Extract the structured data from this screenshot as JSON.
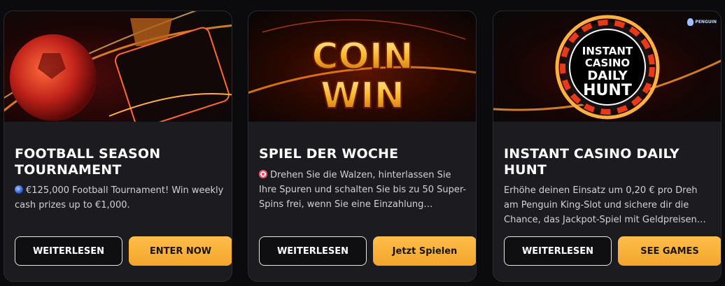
{
  "cards": [
    {
      "title": "FOOTBALL SEASON TOURNAMENT",
      "desc_emoji": "globe-icon",
      "description": "€125,000 Football Tournament! Win weekly cash prizes up to €1,000.",
      "read_label": "WEITERLESEN",
      "cta_label": "ENTER NOW"
    },
    {
      "title": "SPIEL DER WOCHE",
      "desc_emoji": "dart-icon",
      "description": "Drehen Sie die Walzen, hinterlassen Sie Ihre Spuren und schalten Sie bis zu 50 Super-Spins frei, wenn Sie eine Einzahlung…",
      "read_label": "WEITERLESEN",
      "cta_label": "Jetzt Spielen",
      "banner_text_line1": "COIN",
      "banner_text_line2": "WIN"
    },
    {
      "title": "INSTANT CASINO DAILY HUNT",
      "description": "Erhöhe deinen Einsatz um 0,20 € pro Dreh am Penguin King-Slot und sichere dir die Chance, das Jackpot-Spiel mit Geldpreisen…",
      "read_label": "WEITERLESEN",
      "cta_label": "SEE GAMES",
      "banner_text_line1": "INSTANT",
      "banner_text_line2": "CASINO",
      "banner_text_line3": "DAILY",
      "banner_text_line4": "HUNT",
      "banner_logo": "PENGUIN"
    }
  ],
  "colors": {
    "background": "#0b0b0d",
    "card": "#1c1c20",
    "cta": "#f3a52b"
  }
}
